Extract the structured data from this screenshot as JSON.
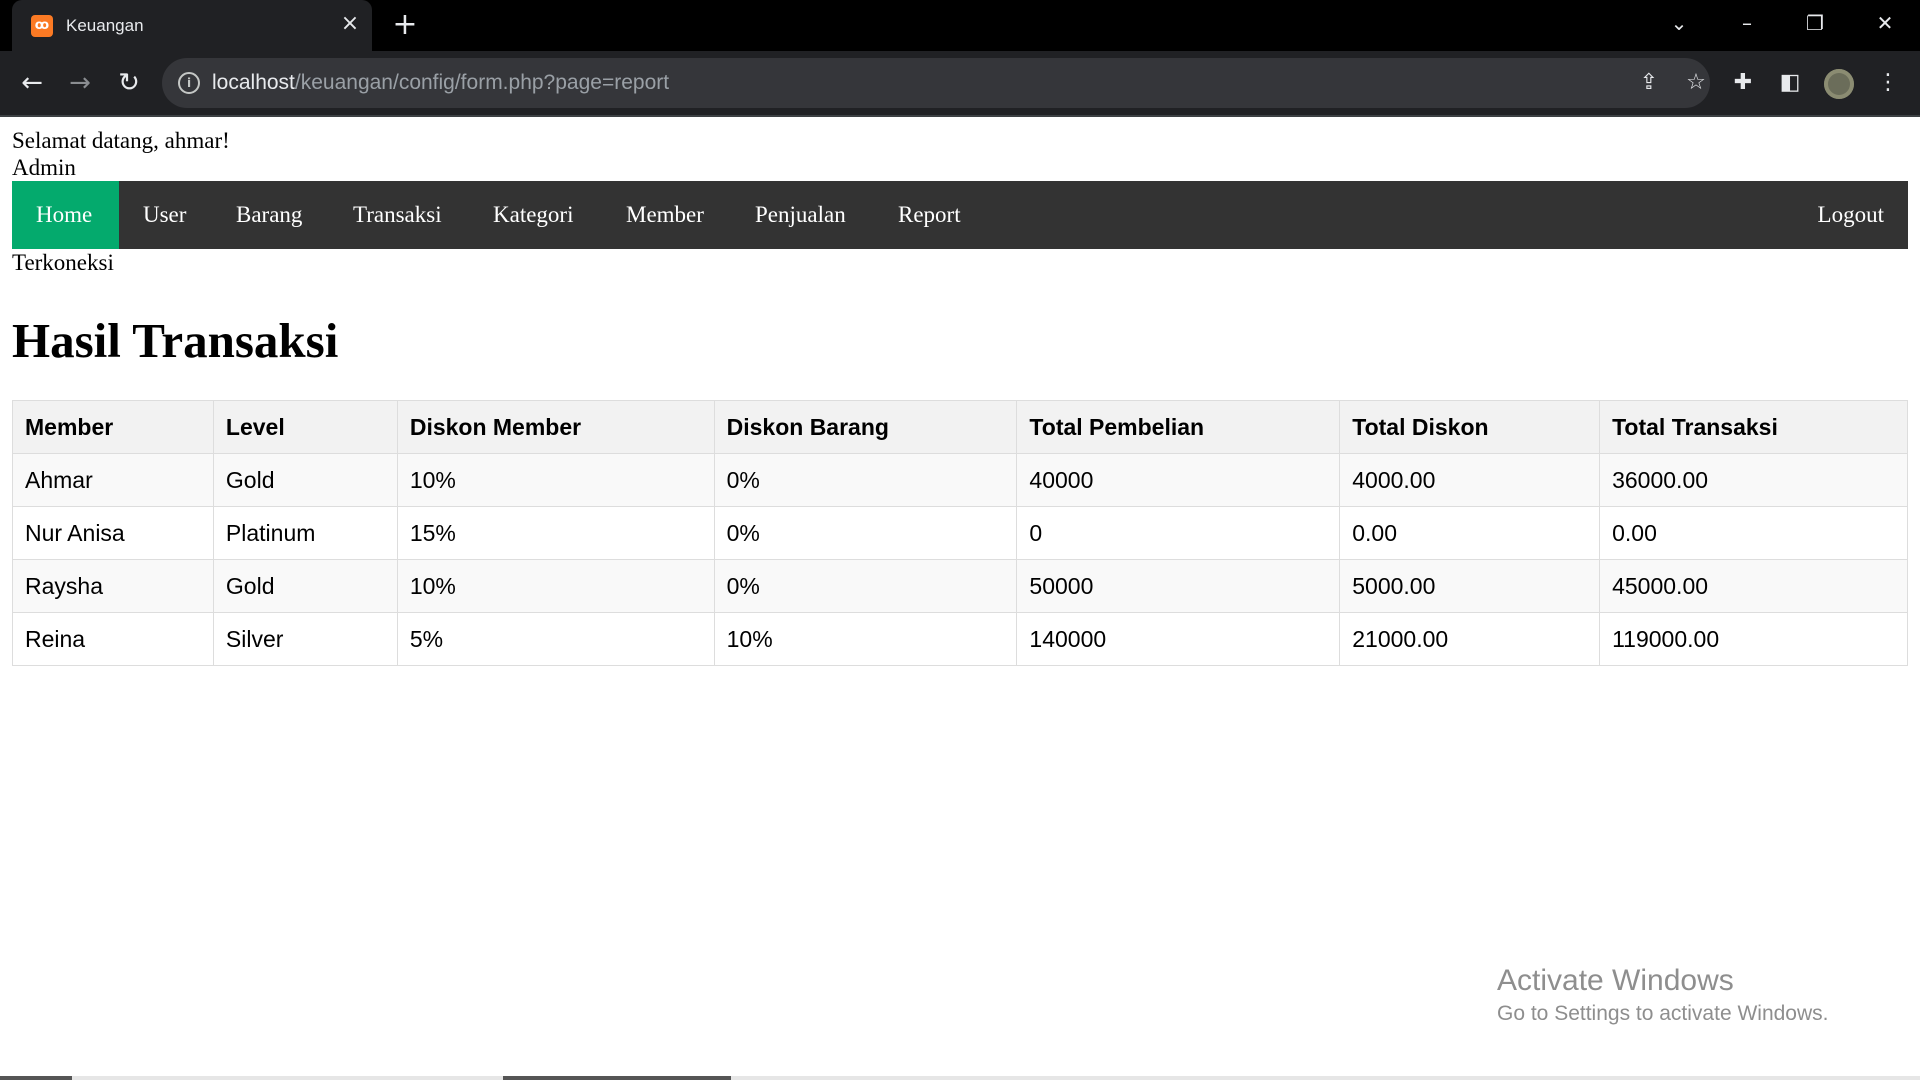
{
  "browser": {
    "tab_title": "Keuangan",
    "url_host": "localhost",
    "url_path": "/keuangan/config/form.php?page=report"
  },
  "page": {
    "welcome": "Selamat datang, ahmar!",
    "role": "Admin",
    "status": "Terkoneksi",
    "title": "Hasil Transaksi"
  },
  "nav": {
    "items": [
      {
        "label": "Home",
        "active": true
      },
      {
        "label": "User",
        "active": false
      },
      {
        "label": "Barang",
        "active": false
      },
      {
        "label": "Transaksi",
        "active": false
      },
      {
        "label": "Kategori",
        "active": false
      },
      {
        "label": "Member",
        "active": false
      },
      {
        "label": "Penjualan",
        "active": false
      },
      {
        "label": "Report",
        "active": false
      }
    ],
    "logout": "Logout",
    "active_color": "#04aa6d",
    "bar_color": "#333333"
  },
  "table": {
    "headers": [
      "Member",
      "Level",
      "Diskon Member",
      "Diskon Barang",
      "Total Pembelian",
      "Total Diskon",
      "Total Transaksi"
    ],
    "rows": [
      [
        "Ahmar",
        "Gold",
        "10%",
        "0%",
        "40000",
        "4000.00",
        "36000.00"
      ],
      [
        "Nur Anisa",
        "Platinum",
        "15%",
        "0%",
        "0",
        "0.00",
        "0.00"
      ],
      [
        "Raysha",
        "Gold",
        "10%",
        "0%",
        "50000",
        "5000.00",
        "45000.00"
      ],
      [
        "Reina",
        "Silver",
        "5%",
        "10%",
        "140000",
        "21000.00",
        "119000.00"
      ]
    ]
  },
  "watermark": {
    "title": "Activate Windows",
    "subtitle": "Go to Settings to activate Windows."
  }
}
